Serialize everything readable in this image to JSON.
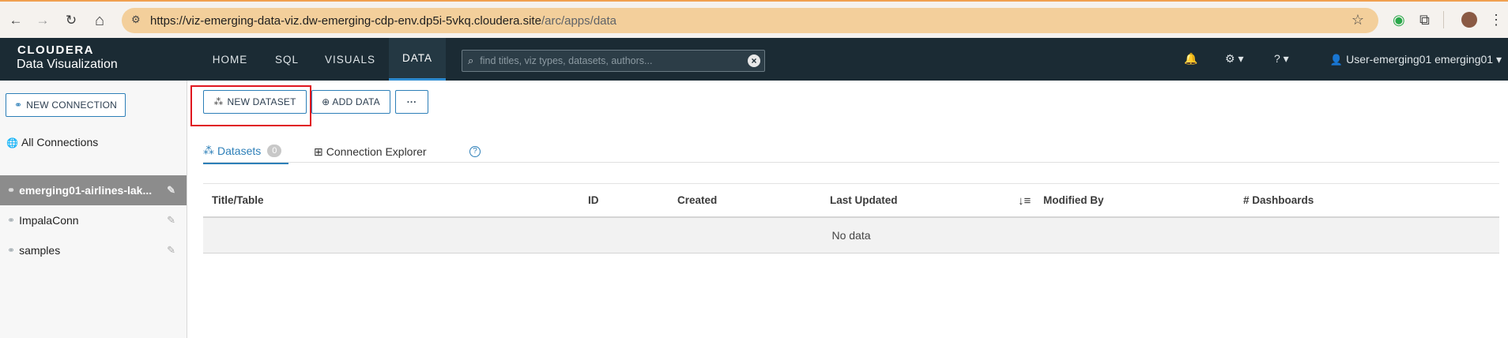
{
  "browser": {
    "url_host": "https://viz-emerging-data-viz.dw-emerging-cdp-env.dp5i-5vkq.cloudera.site",
    "url_path": "/arc/apps/data",
    "back_icon": "←",
    "forward_icon": "→",
    "reload_icon": "↻",
    "home_icon": "⌂",
    "star_icon": "☆"
  },
  "header": {
    "logo_top": "CLOUDERA",
    "logo_bottom": "Data Visualization",
    "nav": [
      "HOME",
      "SQL",
      "VISUALS",
      "DATA"
    ],
    "active_nav": "DATA",
    "search_placeholder": "find titles, viz types, datasets, authors...",
    "user": "User-emerging01 emerging01 ▾",
    "bell_icon": "🔔",
    "gear_icon": "⚙ ▾",
    "help_icon": "? ▾"
  },
  "sidebar": {
    "new_connection": "NEW CONNECTION",
    "all_connections": "All Connections",
    "connections": [
      {
        "label": "emerging01-airlines-lak..."
      },
      {
        "label": "ImpalaConn"
      },
      {
        "label": "samples"
      }
    ]
  },
  "toolbar": {
    "new_dataset": "NEW DATASET",
    "add_data": "ADD DATA",
    "more": "···"
  },
  "tabs": {
    "datasets": "Datasets",
    "datasets_count": "0",
    "connection_explorer": "Connection Explorer",
    "help": "?"
  },
  "table": {
    "columns": [
      "Title/Table",
      "ID",
      "Created",
      "Last Updated",
      "Modified By",
      "# Dashboards"
    ],
    "empty_text": "No data"
  },
  "colors": {
    "header_bg": "#1b2b34",
    "accent": "#2d7fb8",
    "highlight": "#e0161f"
  }
}
